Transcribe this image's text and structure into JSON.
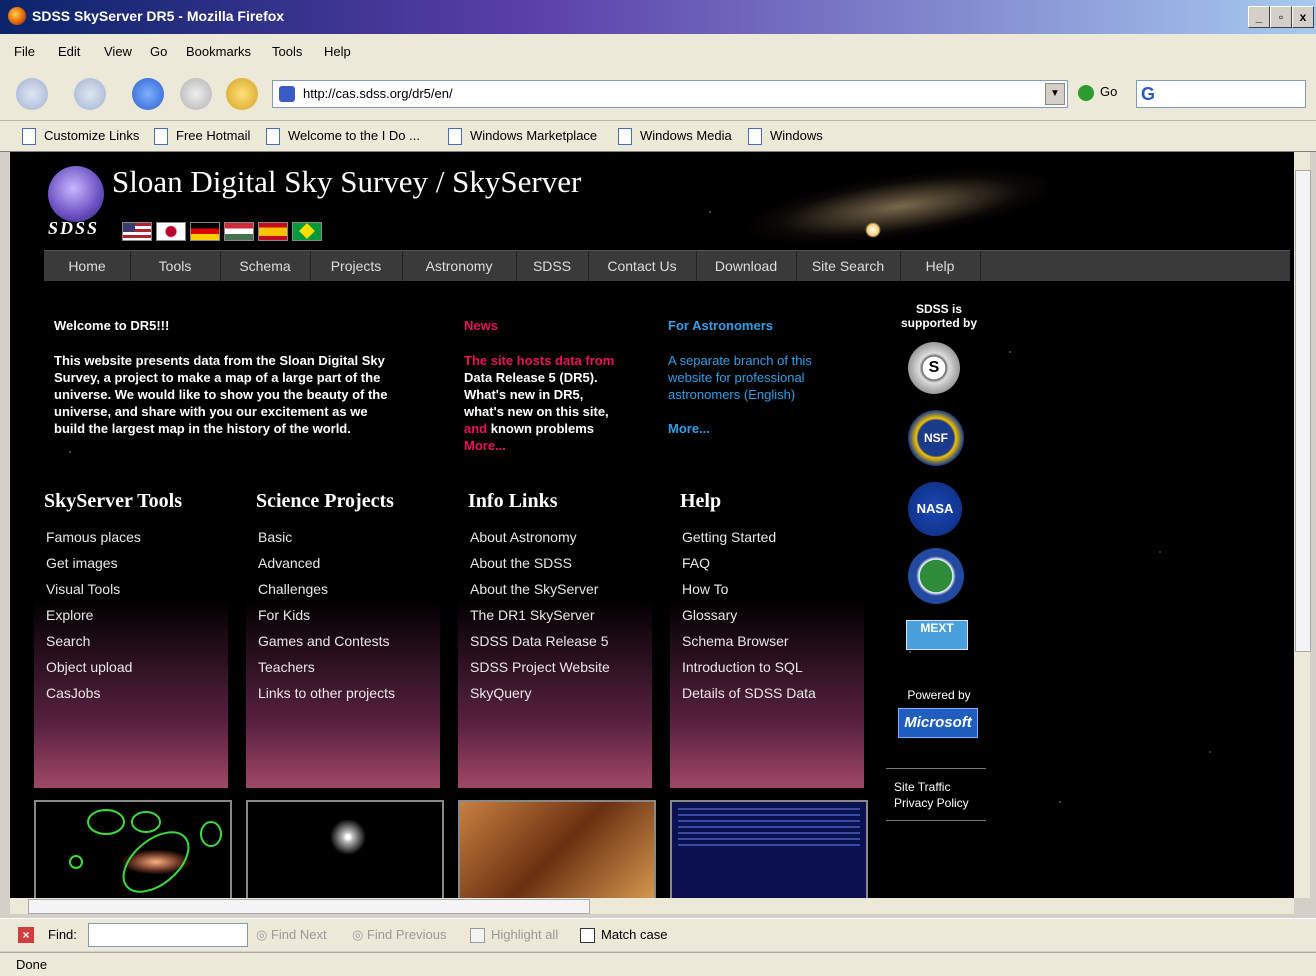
{
  "window": {
    "title": "SDSS SkyServer DR5 - Mozilla Firefox",
    "controls": [
      "_",
      "▫",
      "x"
    ]
  },
  "menu": [
    "File",
    "Edit",
    "View",
    "Go",
    "Bookmarks",
    "Tools",
    "Help"
  ],
  "toolbar": {
    "url": "http://cas.sdss.org/dr5/en/",
    "go_label": "Go"
  },
  "bookmarks": [
    "Customize Links",
    "Free Hotmail",
    "Welcome to the I Do ...",
    "Windows Marketplace",
    "Windows Media",
    "Windows"
  ],
  "page": {
    "logo_text": "SDSS",
    "title": "Sloan Digital Sky Survey / SkyServer",
    "nav": [
      "Home",
      "Tools",
      "Schema",
      "Projects",
      "Astronomy",
      "SDSS",
      "Contact Us",
      "Download",
      "Site Search",
      "Help"
    ],
    "welcome": {
      "heading": "Welcome to DR5!!!",
      "lines": [
        "This website presents data from the Sloan Digital Sky",
        "Survey, a project to make a map of a large part of the",
        "universe. We would like to show you the beauty of the",
        "universe, and share with you our excitement as we",
        "build the largest map in the history of the world."
      ]
    },
    "news": {
      "heading": "News",
      "l1": "The site hosts data from",
      "l2": "Data Release 5 (DR5).",
      "l3": "What's new in DR5,",
      "l4": "what's new on this site,",
      "l5a": "and ",
      "l5b": "known problems",
      "more": "More..."
    },
    "astronomers": {
      "heading": "For Astronomers",
      "lines": [
        "A separate branch of this",
        "website for professional",
        "astronomers (English)"
      ],
      "more": "More..."
    },
    "columns": [
      {
        "heading": "SkyServer Tools",
        "links": [
          "Famous places",
          "Get images",
          "Visual Tools",
          "Explore",
          "Search",
          "Object upload",
          "CasJobs"
        ]
      },
      {
        "heading": "Science Projects",
        "links": [
          "Basic",
          "Advanced",
          "Challenges",
          "For Kids",
          "Games and Contests",
          "Teachers",
          "Links to other projects"
        ]
      },
      {
        "heading": "Info Links",
        "links": [
          "About Astronomy",
          "About the SDSS",
          "About the SkyServer",
          "The DR1 SkyServer",
          "SDSS Data Release 5",
          "SDSS Project Website",
          "SkyQuery"
        ]
      },
      {
        "heading": "Help",
        "links": [
          "Getting Started",
          "FAQ",
          "How To",
          "Glossary",
          "Schema Browser",
          "Introduction to SQL",
          "Details of SDSS Data"
        ]
      }
    ],
    "sidebar": {
      "supported_l1": "SDSS is",
      "supported_l2": "supported by",
      "seal_label": "S",
      "nsf_label": "NSF",
      "nasa_label": "NASA",
      "mext_label": "MEXT",
      "powered_by": "Powered by",
      "microsoft": "Microsoft",
      "site_traffic": "Site Traffic",
      "privacy_policy": "Privacy Policy"
    }
  },
  "findbar": {
    "label": "Find:",
    "value": "",
    "find_next": "Find Next",
    "find_previous": "Find Previous",
    "highlight": "Highlight all",
    "match_case": "Match case"
  },
  "status": "Done"
}
